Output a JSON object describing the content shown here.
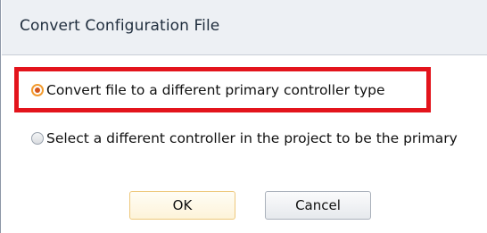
{
  "dialog": {
    "title": "Convert Configuration File"
  },
  "options": [
    {
      "label": "Convert file to a different primary controller type",
      "selected": true
    },
    {
      "label": "Select a different controller in the project to be the primary",
      "selected": false
    }
  ],
  "buttons": {
    "ok_label": "OK",
    "cancel_label": "Cancel"
  },
  "colors": {
    "highlight": "#e3141c",
    "radio_selected": "#d6561d",
    "ok_border": "#eec87c"
  }
}
